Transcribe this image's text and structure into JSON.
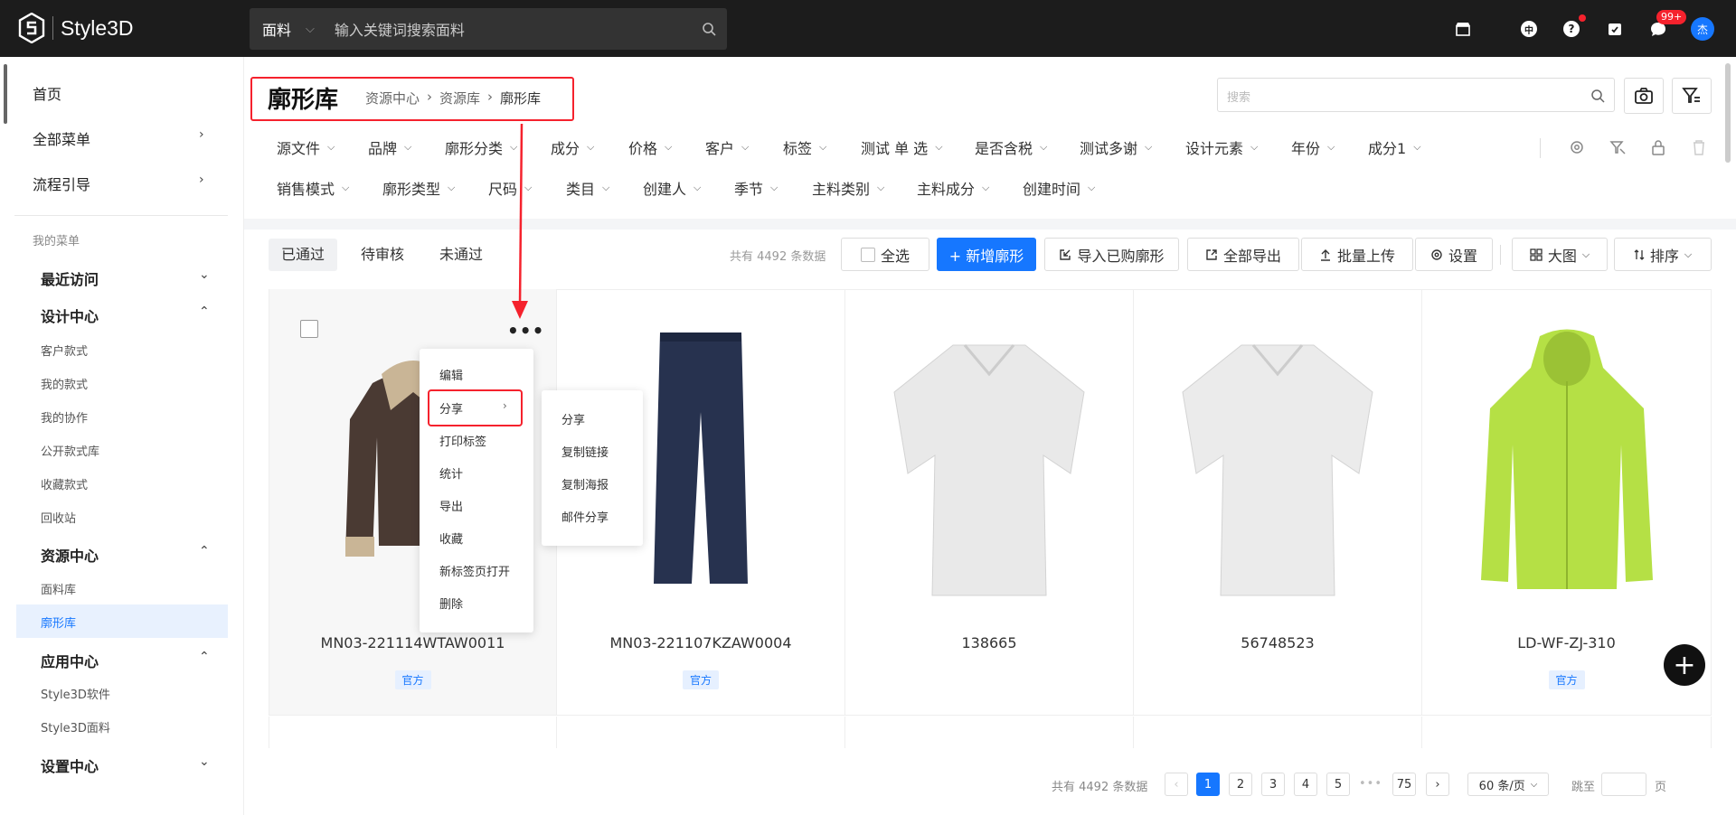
{
  "app": {
    "logo_text": "Style3D"
  },
  "top_search": {
    "category": "面料",
    "placeholder": "输入关键词搜索面料"
  },
  "top_icons": {
    "lang": "中",
    "help": "?",
    "badge": "99+",
    "avatar": "杰"
  },
  "sidebar": {
    "home": "首页",
    "all_menu": "全部菜单",
    "flow_guide": "流程引导",
    "my_menu": "我的菜单",
    "recent": "最近访问",
    "design_center": "设计中心",
    "design_items": [
      "客户款式",
      "我的款式",
      "我的协作",
      "公开款式库",
      "收藏款式",
      "回收站"
    ],
    "resource_center": "资源中心",
    "resource_items": [
      "面料库",
      "廓形库"
    ],
    "app_center": "应用中心",
    "app_items": [
      "Style3D软件",
      "Style3D面料"
    ],
    "settings_center": "设置中心"
  },
  "header": {
    "title": "廓形库",
    "breadcrumb": [
      "资源中心",
      "资源库",
      "廓形库"
    ],
    "search_placeholder": "搜索"
  },
  "filters_row1": [
    "源文件",
    "品牌",
    "廓形分类",
    "成分",
    "价格",
    "客户",
    "标签",
    "测试 单 选",
    "是否含税",
    "测试多谢",
    "设计元素",
    "年份",
    "成分1"
  ],
  "filters_row2": [
    "销售模式",
    "廓形类型",
    "尺码",
    "类目",
    "创建人",
    "季节",
    "主料类别",
    "主料成分",
    "创建时间"
  ],
  "tabs": [
    "已通过",
    "待审核",
    "未通过"
  ],
  "toolbar": {
    "total": "共有 4492 条数据",
    "select_all": "全选",
    "add": "+ 新增廓形",
    "import": "导入已购廓形",
    "export_all": "全部导出",
    "batch_upload": "批量上传",
    "settings": "设置",
    "view": "大图",
    "sort": "排序"
  },
  "cards": [
    {
      "name": "MN03-221114WTAW0011",
      "tag": "官方",
      "color": "#4a3a33"
    },
    {
      "name": "MN03-221107KZAW0004",
      "tag": "官方",
      "color": "#27324f"
    },
    {
      "name": "138665",
      "tag": "",
      "color": "#e9e9e9"
    },
    {
      "name": "56748523",
      "tag": "",
      "color": "#ebebeb"
    },
    {
      "name": "LD-WF-ZJ-310",
      "tag": "官方",
      "color": "#b5e045"
    }
  ],
  "context_menu": [
    "编辑",
    "分享",
    "打印标签",
    "统计",
    "导出",
    "收藏",
    "新标签页打开",
    "删除"
  ],
  "submenu": [
    "分享",
    "复制链接",
    "复制海报",
    "邮件分享"
  ],
  "pagination": {
    "total": "共有 4492 条数据",
    "pages": [
      "1",
      "2",
      "3",
      "4",
      "5"
    ],
    "ellipsis": "•••",
    "last": "75",
    "page_size": "60 条/页",
    "goto": "跳至",
    "page_unit": "页",
    "current": 1
  }
}
